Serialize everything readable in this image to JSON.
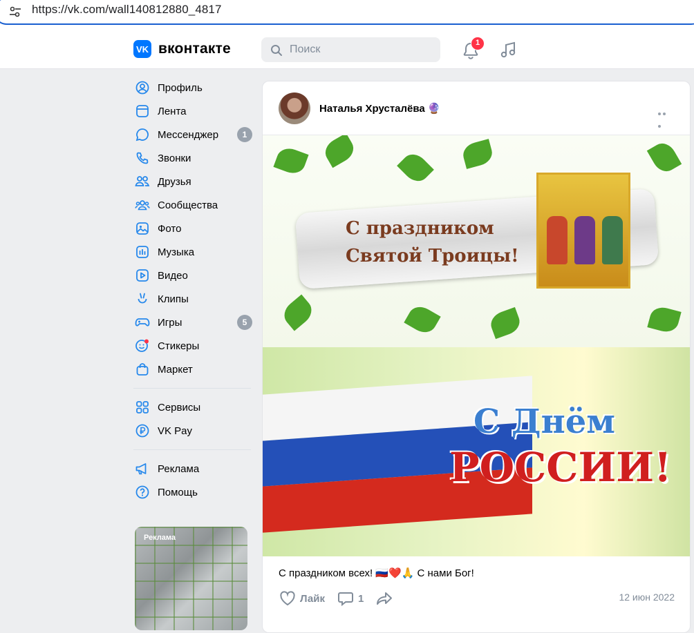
{
  "browser": {
    "url": "https://vk.com/wall140812880_4817"
  },
  "header": {
    "logo_letter": "VK",
    "logo_text": "вконтакте",
    "search_placeholder": "Поиск",
    "notifications_count": "1"
  },
  "sidebar": {
    "items": [
      {
        "label": "Профиль",
        "icon": "profile-icon"
      },
      {
        "label": "Лента",
        "icon": "feed-icon"
      },
      {
        "label": "Мессенджер",
        "icon": "messenger-icon",
        "count": "1"
      },
      {
        "label": "Звонки",
        "icon": "phone-icon"
      },
      {
        "label": "Друзья",
        "icon": "friends-icon"
      },
      {
        "label": "Сообщества",
        "icon": "communities-icon"
      },
      {
        "label": "Фото",
        "icon": "photo-icon"
      },
      {
        "label": "Музыка",
        "icon": "music-icon"
      },
      {
        "label": "Видео",
        "icon": "video-icon"
      },
      {
        "label": "Клипы",
        "icon": "clips-icon"
      },
      {
        "label": "Игры",
        "icon": "games-icon",
        "count": "5"
      },
      {
        "label": "Стикеры",
        "icon": "stickers-icon"
      },
      {
        "label": "Маркет",
        "icon": "market-icon"
      }
    ],
    "services": [
      {
        "label": "Сервисы",
        "icon": "services-icon"
      },
      {
        "label": "VK Pay",
        "icon": "vkpay-icon"
      }
    ],
    "extra": [
      {
        "label": "Реклама",
        "icon": "megaphone-icon"
      },
      {
        "label": "Помощь",
        "icon": "help-icon"
      }
    ],
    "ad_label": "Реклама"
  },
  "post": {
    "author": "Наталья Хрусталёва",
    "author_emoji": "🔮",
    "image1_text_line1": "С праздником",
    "image1_text_line2": "Святой Троицы!",
    "image2_text_line1": "С Днём",
    "image2_text_line2": "РОССИИ!",
    "caption": "С праздником всех! 🇷🇺❤️🙏 С нами Бог!",
    "like_label": "Лайк",
    "comments_count": "1",
    "date": "12 июн 2022"
  },
  "colors": {
    "accent": "#0077ff",
    "badge_red": "#ff3347",
    "muted": "#818c99",
    "background": "#edeef0"
  }
}
